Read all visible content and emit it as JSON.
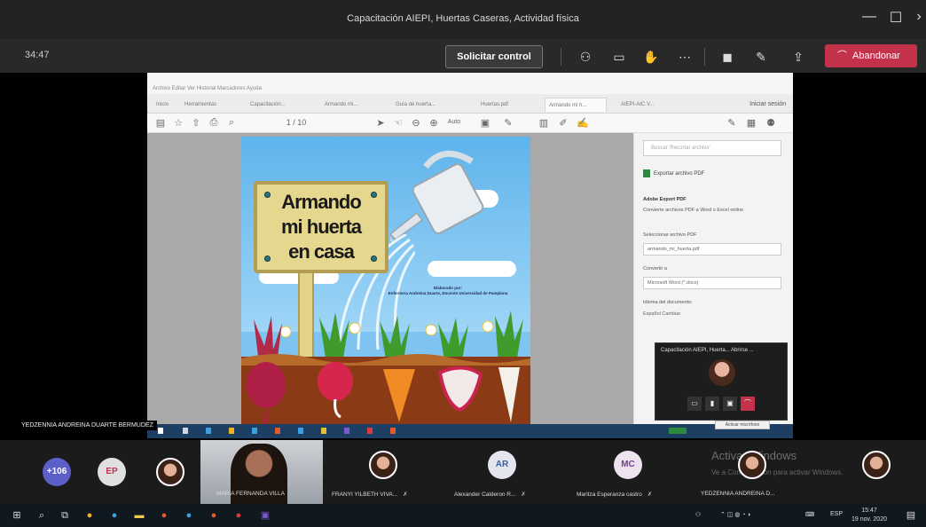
{
  "window": {
    "title": "Capacitación AIEPI, Huertas Caseras, Actividad física",
    "minimize": "—",
    "maximize": "☐",
    "close": "›"
  },
  "call": {
    "timer": "34:47",
    "request_control": "Solicitar control",
    "leave": "Abandonar"
  },
  "shared_screen": {
    "menu": "Archivo Editar Ver Historial Marcadores Ayuda",
    "tabs": [
      "Inicio",
      "Herramientas",
      "Capacitación...",
      "Armando mi...",
      "Guía de huerta...",
      "Huertas.pdf",
      "Armando mi h...",
      "AIEPI-AIC V..."
    ],
    "login": "Iniciar sesión",
    "page_counter": "1 / 10",
    "zoom": "Auto",
    "pdf": {
      "title_lines": [
        "Armando",
        "mi huerta",
        "en casa"
      ],
      "credit_line1": "Elaborado por:",
      "credit_line2": "Enfermera Andreina Duarte, Docente Universidad de Pamplona"
    },
    "right_pane": {
      "search_placeholder": "Buscar 'Recortar archivo'",
      "export_header": "Exportar archivo PDF",
      "export_title": "Adobe Export PDF",
      "export_desc": "Convierte archivos PDF a Word o Excel online",
      "select_label": "Seleccionar archivo PDF",
      "select_value": "armando_mi_huerta.pdf",
      "convert_label": "Convertir a",
      "convert_value": "Microsoft Word (*.docx)",
      "lang_label": "Idioma del documento:",
      "lang_value": "Español Cambiar"
    }
  },
  "mini_call": {
    "title": "Capacitación AIEPI, Huerta...  Abrirse  ...",
    "tooltip": "Activar micrófono"
  },
  "presenter_label": "YEDZENNIA ANDREINA DUARTE BERMUDEZ",
  "participants": [
    {
      "initials": "+106",
      "color": "#5b5fc7"
    },
    {
      "initials": "EP",
      "color": "#e0e0e0",
      "text_color": "#c4314b"
    },
    {
      "photo": true
    },
    {
      "name": "MARIA FERNANDA VILLA",
      "video": true
    },
    {
      "name": "FRANYI YILBETH VIVA...",
      "photo": true
    },
    {
      "name": "Alexander Calderon R...",
      "initials": "AR",
      "color": "#e3e6ef",
      "text_color": "#3b5fa8"
    },
    {
      "name": "Maritza Esperanza castro",
      "initials": "MC",
      "color": "#ece3ef",
      "text_color": "#7a3b8f"
    },
    {
      "name": "YEDZENNIA ANDREINA D...",
      "photo": true
    },
    {
      "photo": true
    }
  ],
  "watermark": {
    "line1": "Activar Windows",
    "line2": "Ve a Configuración para activar Windows."
  },
  "taskbar": {
    "time": "15:47",
    "date": "19 nov. 2020",
    "lang": "ESP"
  }
}
